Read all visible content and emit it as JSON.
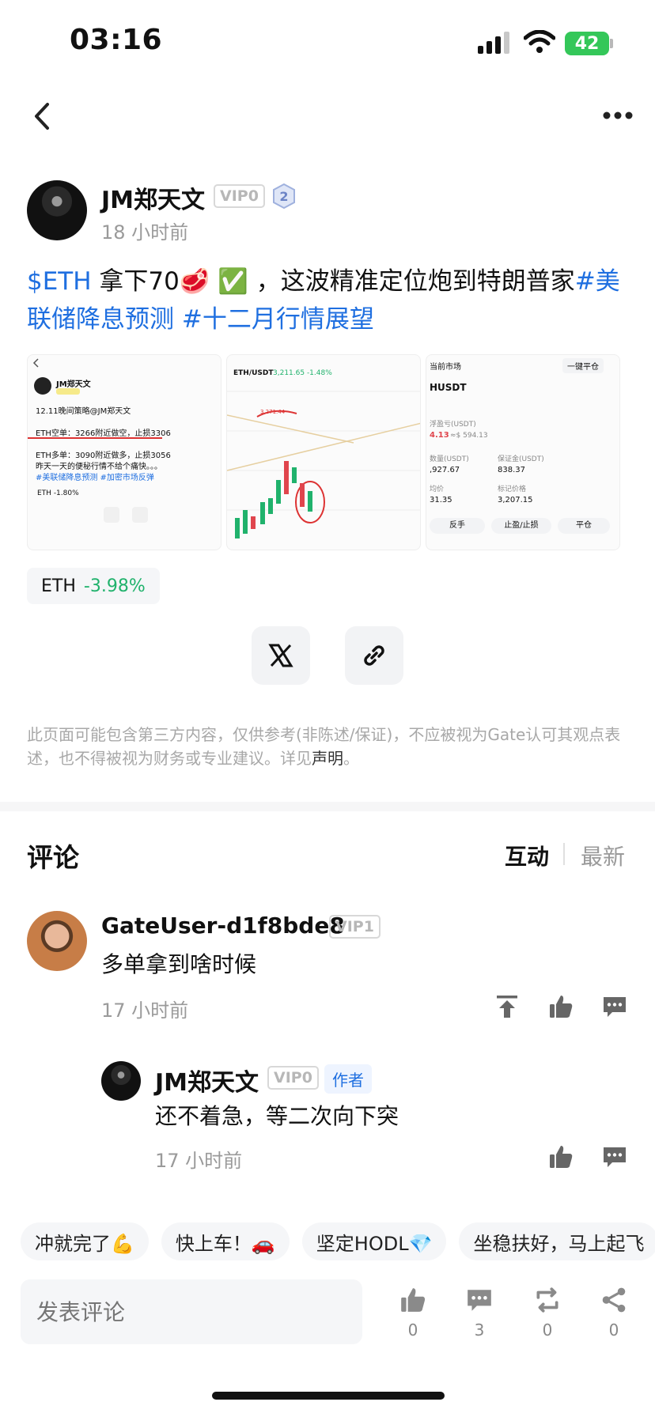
{
  "status_bar": {
    "time": "03:16",
    "battery": "42"
  },
  "author": {
    "name": "JM郑天文",
    "vip": "VIP0",
    "level": "2",
    "posted": "18 小时前"
  },
  "post": {
    "ticker": "$ETH",
    "text1": " 拿下70🥩 ✅ ，这波精准定位炮到特朗普家",
    "tag1": "#美联储降息预测",
    "tag2": "#十二月行情展望"
  },
  "images": {
    "img1": {
      "name": "JM郑天文",
      "line1": "12.11晚间策略@JM郑天文",
      "line2": "ETH空单：3266附近做空，止损3306",
      "line3": "ETH多单：3090附近做多，止损3056",
      "line4": "昨天一天的便秘行情不给个痛快。。。",
      "line5": "#美联储降息预测 #加密市场反弹",
      "line6": "ETH -1.80%"
    },
    "img2": {
      "pair": "ETH/USDT",
      "price": "3,211.65 -1.48%",
      "level": "3,271.44"
    },
    "img3": {
      "title": "当前市场",
      "btn": "一键平仓",
      "pair": "HUSDT",
      "pnl_label": "浮盈亏(USDT)",
      "pnl": "4.13",
      "pnl_sub": "≈$ 594.13",
      "qty_label": "数量(USDT)",
      "qty": ",927.67",
      "margin_label": "保证金(USDT)",
      "margin": "838.37",
      "avg_label": "均价",
      "avg": "31.35",
      "mark_label": "标记价格",
      "mark": "3,207.15",
      "b1": "反手",
      "b2": "止盈/止损",
      "b3": "平仓"
    }
  },
  "eth_chip": {
    "symbol": "ETH",
    "change": "-3.98%"
  },
  "disclaimer": {
    "text": "此页面可能包含第三方内容，仅供参考(非陈述/保证)，不应被视为Gate认可其观点表述，也不得被视为财务或专业建议。详见",
    "link": "声明",
    "end": "。"
  },
  "comments_section": {
    "title": "评论",
    "sort_hot": "互动",
    "sort_new": "最新",
    "comments": [
      {
        "name": "GateUser-d1f8bde8",
        "vip": "VIP1",
        "text": "多单拿到啥时候",
        "time": "17 小时前"
      },
      {
        "name": "JM郑天文",
        "vip": "VIP0",
        "tag": "作者",
        "text": "还不着急，等二次向下突",
        "time": "17 小时前"
      }
    ]
  },
  "quick_replies": [
    "冲就完了💪",
    "快上车！🚗",
    "坚定HODL💎",
    "坐稳扶好，马上起飞"
  ],
  "bottom_bar": {
    "placeholder": "发表评论",
    "likes": "0",
    "comments": "3",
    "reposts": "0",
    "shares": "0"
  },
  "colors": {
    "accent": "#1f6fe0",
    "positive": "#20b26c",
    "negative": "#e0454d"
  }
}
